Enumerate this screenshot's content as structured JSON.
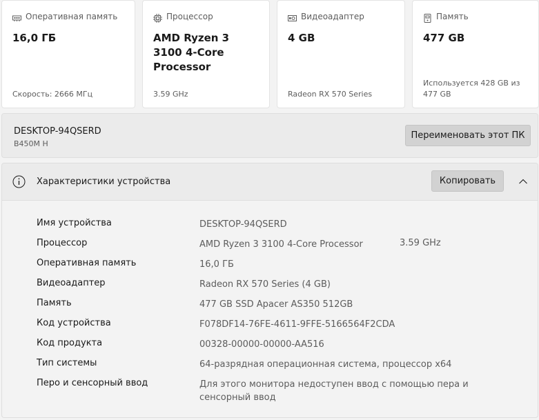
{
  "cards": [
    {
      "icon": "ram-icon",
      "title": "Оперативная память",
      "value": "16,0 ГБ",
      "sub": "Скорость: 2666 МГц"
    },
    {
      "icon": "processor-icon",
      "title": "Процессор",
      "value": "AMD Ryzen 3 3100 4-Core Processor",
      "sub": "3.59 GHz"
    },
    {
      "icon": "gpu-icon",
      "title": "Видеоадаптер",
      "value": "4 GB",
      "sub": "Radeon RX 570 Series"
    },
    {
      "icon": "storage-icon",
      "title": "Память",
      "value": "477 GB",
      "sub": "Используется 428 GB из 477 GB"
    }
  ],
  "pc": {
    "name": "DESKTOP-94QSERD",
    "model": "B450M H",
    "rename_label": "Переименовать этот ПК"
  },
  "specs": {
    "title": "Характеристики устройства",
    "copy_label": "Копировать",
    "rows": [
      {
        "label": "Имя устройства",
        "value": "DESKTOP-94QSERD"
      },
      {
        "label": "Процессор",
        "value": "AMD Ryzen 3 3100 4-Core Processor",
        "extra": "3.59 GHz"
      },
      {
        "label": "Оперативная память",
        "value": "16,0 ГБ"
      },
      {
        "label": "Видеоадаптер",
        "value": "Radeon RX 570 Series (4 GB)"
      },
      {
        "label": "Память",
        "value": "477 GB SSD Apacer AS350 512GB"
      },
      {
        "label": "Код устройства",
        "value": "F078DF14-76FE-4611-9FFE-5166564F2CDA"
      },
      {
        "label": "Код продукта",
        "value": "00328-00000-00000-AA516"
      },
      {
        "label": "Тип системы",
        "value": "64-разрядная операционная система, процессор x64"
      },
      {
        "label": "Перо и сенсорный ввод",
        "value": "Для этого монитора недоступен ввод с помощью пера и сенсорный ввод"
      }
    ]
  }
}
